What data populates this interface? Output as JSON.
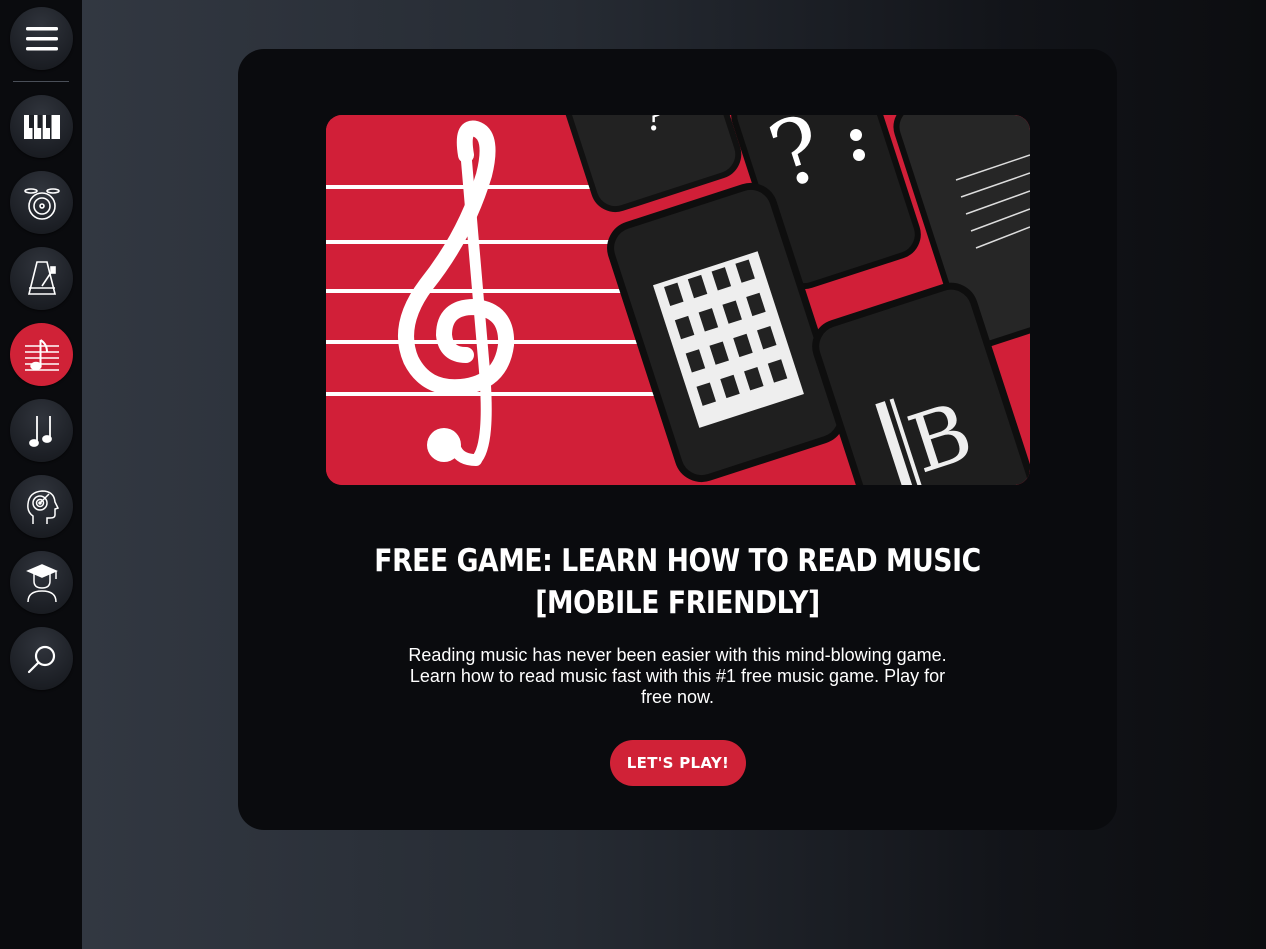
{
  "sidebar": {
    "items": [
      {
        "name": "menu",
        "icon": "hamburger-menu-icon",
        "active": false
      },
      {
        "name": "piano",
        "icon": "piano-keys-icon",
        "active": false
      },
      {
        "name": "drums",
        "icon": "drum-icon",
        "active": false
      },
      {
        "name": "metronome",
        "icon": "metronome-icon",
        "active": false
      },
      {
        "name": "read-music",
        "icon": "music-staff-note-icon",
        "active": true
      },
      {
        "name": "rhythm",
        "icon": "music-note-icon",
        "active": false
      },
      {
        "name": "ear-training",
        "icon": "head-target-icon",
        "active": false
      },
      {
        "name": "lessons",
        "icon": "graduate-icon",
        "active": false
      },
      {
        "name": "search",
        "icon": "search-icon",
        "active": false
      }
    ]
  },
  "card": {
    "image_alt": "Treble clef on red staff with phones showing bass clef, piano keys and alto clef",
    "title_line1": "FREE GAME: LEARN HOW TO READ MUSIC",
    "title_line2": "[MOBILE FRIENDLY]",
    "description": "Reading music has never been easier with this mind-blowing game. Learn how to read music fast with this #1 free music game. Play for free now.",
    "cta_label": "LET'S PLAY!"
  },
  "colors": {
    "accent": "#d02237",
    "card_bg": "#0a0b0e",
    "sidebar_bg": "#0a0b0e"
  }
}
